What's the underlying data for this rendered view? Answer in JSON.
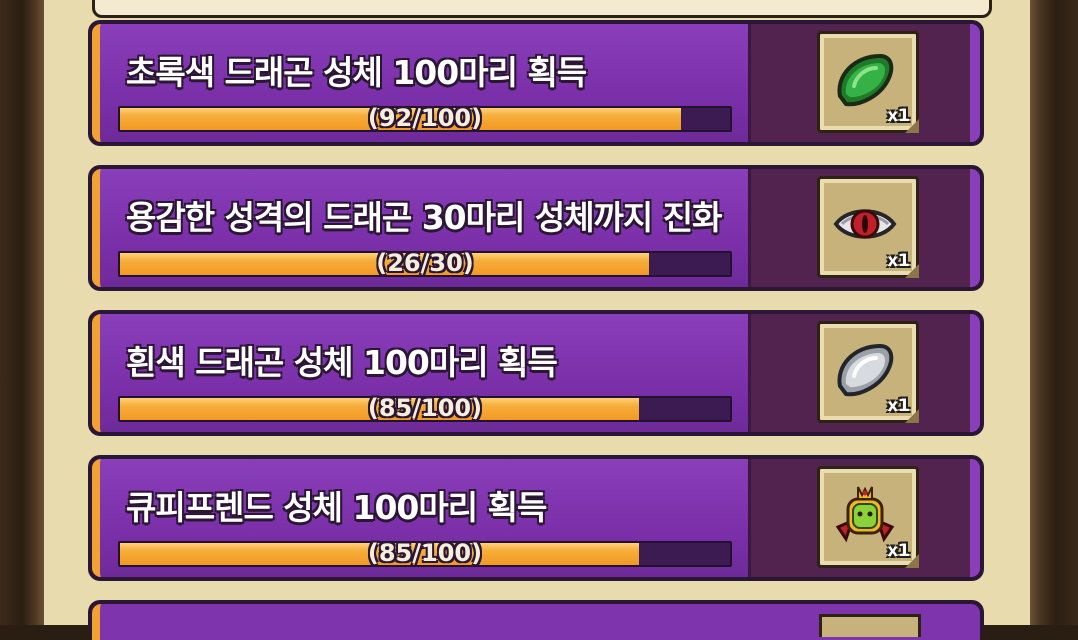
{
  "quests": [
    {
      "title": "초록색 드래곤 성체 100마리 획득",
      "progress_text": "(92/100)",
      "progress_fraction": 0.92,
      "reward_icon": "green-scale-icon",
      "reward_count": "x1"
    },
    {
      "title": "용감한 성격의 드래곤 30마리 성체까지 진화",
      "progress_text": "(26/30)",
      "progress_fraction": 0.8667,
      "reward_icon": "dragon-eye-icon",
      "reward_count": "x1"
    },
    {
      "title": "흰색 드래곤 성체 100마리 획득",
      "progress_text": "(85/100)",
      "progress_fraction": 0.85,
      "reward_icon": "white-scale-icon",
      "reward_count": "x1"
    },
    {
      "title": "큐피프렌드 성체 100마리 획득",
      "progress_text": "(85/100)",
      "progress_fraction": 0.85,
      "reward_icon": "cupid-badge-icon",
      "reward_count": "x1"
    }
  ],
  "colors": {
    "card_purple": "#7d34ad",
    "progress_orange": "#f29a25",
    "panel_beige": "#e8dcae"
  }
}
